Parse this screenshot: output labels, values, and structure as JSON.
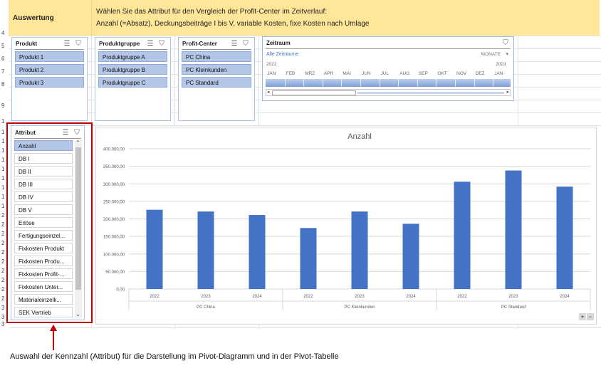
{
  "header": {
    "title": "Auswertung",
    "line1": "Wählen Sie das Attribut für den Vergleich der Profit-Center im Zeitverlauf:",
    "line2": "Anzahl (=Absatz), Deckungsbeiträge I bis V, variable Kosten, fixe Kosten nach Umlage"
  },
  "row_numbers": [
    "4",
    "5",
    "6",
    "7",
    "8",
    "9",
    "1",
    "1",
    "1",
    "1",
    "1",
    "1",
    "1",
    "1",
    "1",
    "1",
    "2",
    "2",
    "2",
    "2",
    "2",
    "2",
    "2",
    "2",
    "2",
    "2",
    "3",
    "3",
    "3"
  ],
  "slicers": {
    "produkt": {
      "title": "Produkt",
      "items": [
        "Produkt 1",
        "Produkt 2",
        "Produkt 3"
      ]
    },
    "produktgruppe": {
      "title": "Produktgruppe",
      "items": [
        "Produktgruppe A",
        "Produktgruppe B",
        "Produktgruppe C"
      ]
    },
    "profit_center": {
      "title": "Profit-Center",
      "items": [
        "PC China",
        "PC Kleinkunden",
        "PC Standard"
      ]
    },
    "attribut": {
      "title": "Attribut",
      "selected": "Anzahl",
      "items": [
        "Anzahl",
        "DB I",
        "DB II",
        "DB III",
        "DB IV",
        "DB V",
        "Erlöse",
        "Fertigungseinzel...",
        "Fixkosten Produkt",
        "Fixkosten Produ...",
        "Fixkosten Profit-...",
        "Fixkosten Unter...",
        "Materialeinzelk...",
        "SEK Vertrieb"
      ]
    }
  },
  "timeline": {
    "title": "Zeitraum",
    "all_periods": "Alle Zeiträume",
    "level": "MONATE",
    "year_left": "2022",
    "year_right": "2023",
    "months": [
      "JAN",
      "FEB",
      "MRZ",
      "APR",
      "MAI",
      "JUN",
      "JUL",
      "AUG",
      "SEP",
      "OKT",
      "NOV",
      "DEZ",
      "JAN"
    ]
  },
  "icons": {
    "multiselect": "multi-select-icon",
    "clear_filter": "clear-filter-icon",
    "scroll_up": "chevron-up-icon",
    "scroll_down": "chevron-down-icon",
    "zoom": "zoom-icon"
  },
  "colors": {
    "bar": "#4472c4",
    "banner": "#ffe699",
    "selected_item": "#b4c6e7",
    "annotation": "#c00000"
  },
  "chart_data": {
    "type": "bar",
    "title": "Anzahl",
    "groups": [
      "PC China",
      "PC Kleinkunden",
      "PC Standard"
    ],
    "categories": [
      "2022",
      "2023",
      "2024",
      "2022",
      "2023",
      "2024",
      "2022",
      "2023",
      "2024"
    ],
    "values": [
      226000,
      221000,
      211000,
      174000,
      221000,
      186000,
      306000,
      338000,
      292000
    ],
    "ylim": [
      0,
      400000
    ],
    "yticks": [
      "0,00",
      "50.000,00",
      "100.000,00",
      "150.000,00",
      "200.000,00",
      "250.000,00",
      "300.000,00",
      "350.000,00",
      "400.000,00"
    ],
    "grid": true,
    "legend": "none"
  },
  "annotation": {
    "arrow": "up-arrow",
    "text": "Auswahl der Kennzahl (Attribut) für die Darstellung im Pivot-Diagramm  und in der Pivot-Tabelle"
  },
  "chart_buttons": {
    "plus": "+",
    "minus": "−"
  }
}
